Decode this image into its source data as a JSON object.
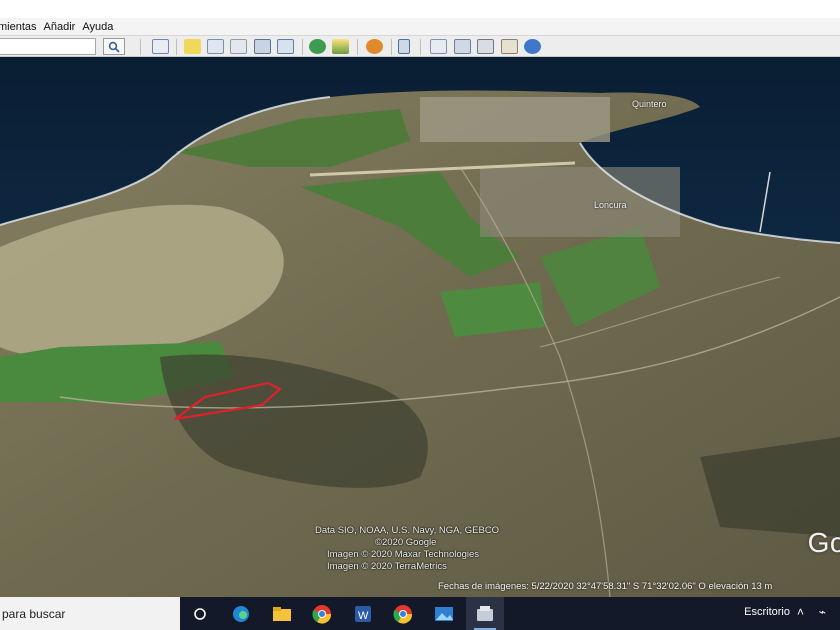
{
  "menu": [
    "mientas",
    "Añadir",
    "Ayuda"
  ],
  "toolbar": {
    "search_icon": "search-icon",
    "tools": [
      "sidebar-toggle-icon",
      "placemark-icon",
      "polygon-icon",
      "path-icon",
      "overlay-icon",
      "tour-icon",
      "historical-imagery-icon",
      "sunlight-icon",
      "planets-icon",
      "ruler-icon",
      "email-icon",
      "print-icon",
      "save-image-icon",
      "maps-view-icon",
      "web-icon"
    ]
  },
  "map": {
    "place_labels": [
      "Quintero",
      "Loncura"
    ],
    "attribution": [
      "Data SIO, NOAA, U.S. Navy, NGA, GEBCO",
      "©2020 Google",
      "Imagen © 2020 Maxar Technologies",
      "Imagen © 2020 TerraMetrics"
    ],
    "status": "Fechas de imágenes: 5/22/2020   32°47'58.31\" S   71°32'02.06\" O   elevación   13 m",
    "logo": "Go",
    "colors": {
      "ocean": "#0d2a45",
      "boundary": "#e0202a",
      "land": "#6f6a4f"
    }
  },
  "taskbar": {
    "search_text": "para buscar",
    "apps": [
      "cortana-icon",
      "edge-icon",
      "file-explorer-icon",
      "chrome-icon",
      "word-icon",
      "chrome-icon",
      "photos-icon",
      "google-earth-icon"
    ],
    "tray_label": "Escritorio"
  }
}
